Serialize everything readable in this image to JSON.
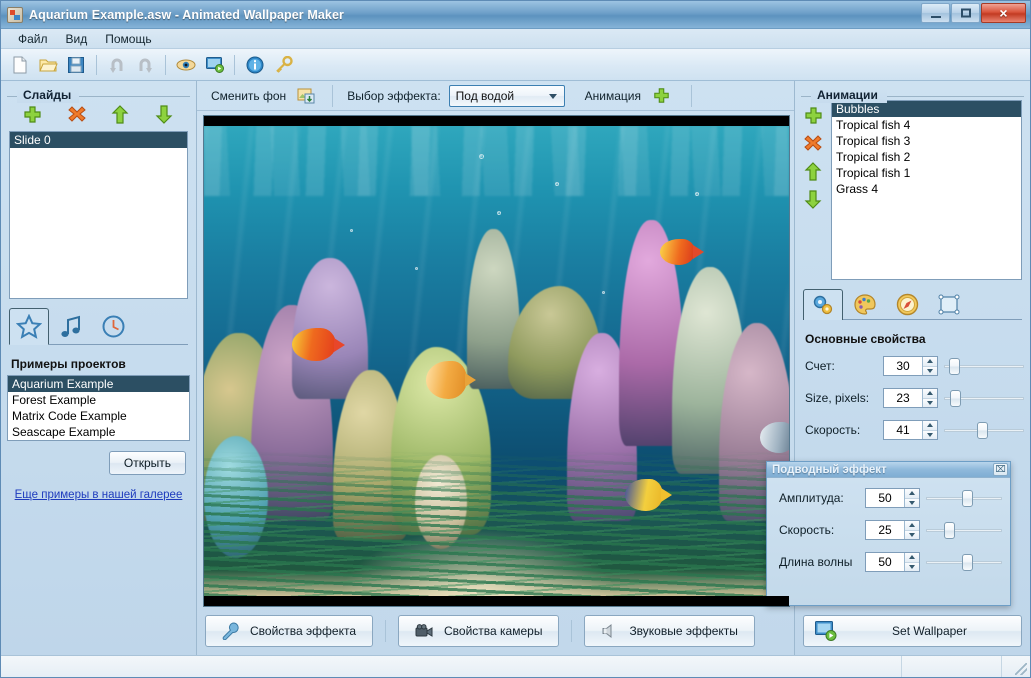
{
  "window": {
    "title": "Aquarium Example.asw - Animated Wallpaper Maker",
    "app_icon": "app-icon",
    "minimize_label": "",
    "maximize_label": "",
    "close_label": "×"
  },
  "menu": {
    "items": [
      {
        "label": "Файл",
        "name": "menu-file"
      },
      {
        "label": "Вид",
        "name": "menu-view"
      },
      {
        "label": "Помощь",
        "name": "menu-help"
      }
    ]
  },
  "toolbar": {
    "buttons": [
      {
        "icon": "new-document-icon",
        "name": "toolbar-new"
      },
      {
        "icon": "open-folder-icon",
        "name": "toolbar-open"
      },
      {
        "icon": "save-floppy-icon",
        "name": "toolbar-save"
      },
      {
        "icon": "undo-arrow-icon",
        "name": "toolbar-undo"
      },
      {
        "icon": "redo-arrow-icon",
        "name": "toolbar-redo"
      },
      {
        "icon": "eye-preview-icon",
        "name": "toolbar-preview"
      },
      {
        "icon": "monitor-play-icon",
        "name": "toolbar-set-wallpaper"
      },
      {
        "icon": "info-circle-icon",
        "name": "toolbar-info"
      },
      {
        "icon": "key-icon",
        "name": "toolbar-register"
      }
    ]
  },
  "left_panel": {
    "slides_group_label": "Слайды",
    "slide_actions": [
      {
        "icon": "plus-icon",
        "name": "add-slide-button"
      },
      {
        "icon": "delete-x-icon",
        "name": "delete-slide-button"
      },
      {
        "icon": "arrow-up-icon",
        "name": "move-slide-up-button"
      },
      {
        "icon": "arrow-down-icon",
        "name": "move-slide-down-button"
      }
    ],
    "slides": [
      {
        "label": "Slide 0",
        "selected": true
      }
    ],
    "tabs": [
      {
        "icon": "star-icon",
        "name": "tab-examples",
        "active": true
      },
      {
        "icon": "music-note-icon",
        "name": "tab-music",
        "active": false
      },
      {
        "icon": "clock-icon",
        "name": "tab-schedule",
        "active": false
      }
    ],
    "examples_title": "Примеры проектов",
    "examples": [
      {
        "label": "Aquarium Example",
        "selected": true
      },
      {
        "label": "Forest Example",
        "selected": false
      },
      {
        "label": "Matrix Code Example",
        "selected": false
      },
      {
        "label": "Seascape Example",
        "selected": false
      }
    ],
    "open_button": "Открыть",
    "gallery_link": "Еще примеры в нашей галерее"
  },
  "center_toolbar": {
    "change_background_label": "Сменить фон",
    "change_background_icon": "image-export-icon",
    "effect_label": "Выбор эффекта:",
    "effect_value": "Под водой",
    "animation_label": "Анимация",
    "animation_add_icon": "plus-icon"
  },
  "preview": {
    "scene_name": "aquarium-preview"
  },
  "bottom_buttons": [
    {
      "label": "Свойства эффекта",
      "icon": "wrench-icon",
      "name": "effect-properties-button"
    },
    {
      "label": "Свойства камеры",
      "icon": "camera-icon",
      "name": "camera-properties-button"
    },
    {
      "label": "Звуковые эффекты",
      "icon": "speaker-icon",
      "name": "sound-effects-button"
    }
  ],
  "right_panel": {
    "group_label": "Анимации",
    "actions": [
      {
        "icon": "plus-icon",
        "name": "add-animation-button"
      },
      {
        "icon": "delete-x-icon",
        "name": "delete-animation-button"
      },
      {
        "icon": "arrow-up-icon",
        "name": "move-animation-up-button"
      },
      {
        "icon": "arrow-down-icon",
        "name": "move-animation-down-button"
      }
    ],
    "animations": [
      {
        "label": "Bubbles",
        "selected": true
      },
      {
        "label": "Tropical fish 4",
        "selected": false
      },
      {
        "label": "Tropical fish 3",
        "selected": false
      },
      {
        "label": "Tropical fish 2",
        "selected": false
      },
      {
        "label": "Tropical fish 1",
        "selected": false
      },
      {
        "label": "Grass 4",
        "selected": false
      }
    ],
    "property_tabs": [
      {
        "icon": "gears-icon",
        "name": "tab-main-properties",
        "active": true
      },
      {
        "icon": "palette-icon",
        "name": "tab-color-properties",
        "active": false
      },
      {
        "icon": "compass-icon",
        "name": "tab-motion-properties",
        "active": false
      },
      {
        "icon": "selection-box-icon",
        "name": "tab-bounds-properties",
        "active": false
      }
    ],
    "properties_title": "Основные свойства",
    "properties": [
      {
        "label": "Счет:",
        "value": "30",
        "slider_percent": 6,
        "name": "count"
      },
      {
        "label": "Size, pixels:",
        "value": "23",
        "slider_percent": 8,
        "name": "size"
      },
      {
        "label": "Скорость:",
        "value": "41",
        "slider_percent": 41,
        "name": "speed"
      }
    ],
    "set_wallpaper_label": "Set Wallpaper",
    "set_wallpaper_icon": "monitor-play-icon"
  },
  "dialog": {
    "title": "Подводный эффект",
    "close_glyph": "⌧",
    "rows": [
      {
        "label": "Амплитуда:",
        "value": "50",
        "slider_percent": 50,
        "name": "amplitude"
      },
      {
        "label": "Скорость:",
        "value": "25",
        "slider_percent": 25,
        "name": "speed"
      },
      {
        "label": "Длина волны",
        "value": "50",
        "slider_percent": 50,
        "name": "wavelength"
      }
    ]
  },
  "statusbar": {
    "left_text": "",
    "middle_text": "",
    "right_text": ""
  },
  "colors": {
    "title_bar": "#6d9fc8",
    "panel_bg": "#cde1f1",
    "selection": "#2c4f63",
    "link": "#1e3bbd",
    "close_button": "#c23a22"
  }
}
